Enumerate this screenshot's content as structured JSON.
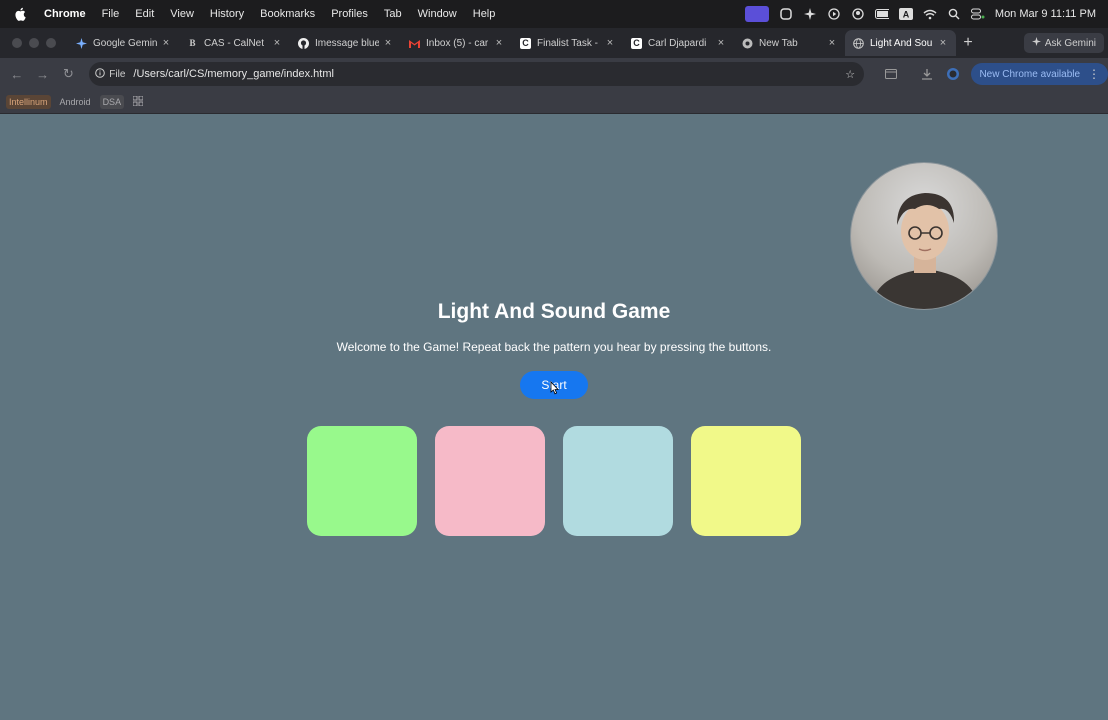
{
  "menubar": {
    "items": [
      "Chrome",
      "File",
      "Edit",
      "View",
      "History",
      "Bookmarks",
      "Profiles",
      "Tab",
      "Window",
      "Help"
    ],
    "clock": "Mon Mar 9  11:11 PM"
  },
  "tabs": [
    {
      "label": "Google Gemini",
      "favicon": "gemini-icon"
    },
    {
      "label": "CAS - CalNet",
      "favicon": "B"
    },
    {
      "label": "Imessage blue",
      "favicon": "github-icon"
    },
    {
      "label": "Inbox (5) - car",
      "favicon": "gmail-icon"
    },
    {
      "label": "Finalist Task -",
      "favicon": "C"
    },
    {
      "label": "Carl Djapardi",
      "favicon": "C"
    },
    {
      "label": "New Tab",
      "favicon": "chrome-icon"
    },
    {
      "label": "Light And Sou",
      "favicon": "globe-icon",
      "active": true
    }
  ],
  "ask_gemini": "Ask Gemini",
  "omnibox": {
    "chip": "File",
    "url": "/Users/carl/CS/memory_game/index.html"
  },
  "update_label": "New Chrome available",
  "bookmarks": [
    "Intellinum",
    "Android",
    "DSA"
  ],
  "game": {
    "title": "Light And Sound Game",
    "subtitle": "Welcome to the Game! Repeat back the pattern you hear by pressing the buttons.",
    "start_label": "Start",
    "pads": [
      {
        "name": "green",
        "color": "#98f98c"
      },
      {
        "name": "pink",
        "color": "#f6bac8"
      },
      {
        "name": "blue",
        "color": "#b1dbe0"
      },
      {
        "name": "yellow",
        "color": "#f1f989"
      }
    ]
  },
  "colors": {
    "page_bg": "#5f7580",
    "start_button": "#1677f0",
    "menubar_bg": "#1c1c1e",
    "toolbar_bg": "#3a3c44"
  }
}
